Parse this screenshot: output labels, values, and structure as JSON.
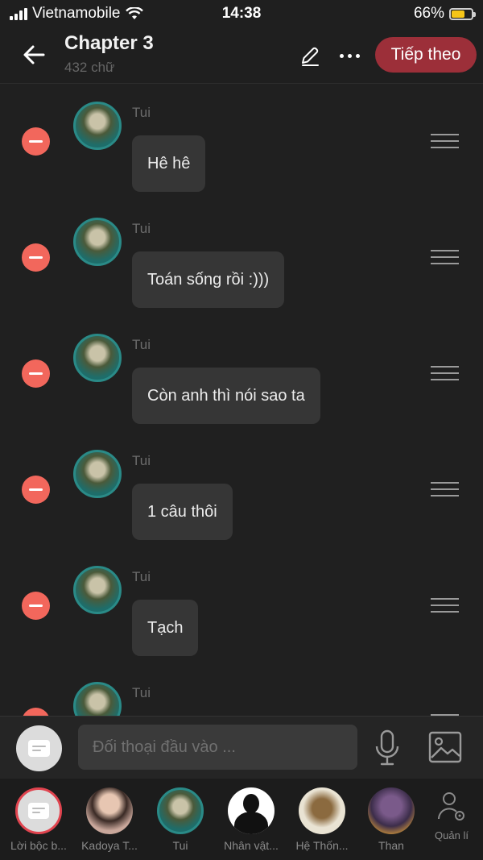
{
  "status_bar": {
    "carrier": "Vietnamobile",
    "time": "14:38",
    "battery": "66%",
    "battery_level": 0.66
  },
  "header": {
    "title": "Chapter 3",
    "word_count": "432 chữ",
    "next_label": "Tiếp theo"
  },
  "messages": [
    {
      "speaker": "Tui",
      "text": "Hê hê"
    },
    {
      "speaker": "Tui",
      "text": "Toán sống rồi :)))"
    },
    {
      "speaker": "Tui",
      "text": "Còn anh thì nói sao ta"
    },
    {
      "speaker": "Tui",
      "text": "1 câu thôi"
    },
    {
      "speaker": "Tui",
      "text": "Tạch"
    },
    {
      "speaker": "Tui",
      "text": ""
    }
  ],
  "input": {
    "placeholder": "Đối thoại đầu vào ..."
  },
  "characters": [
    {
      "label": "Lời bộc b..."
    },
    {
      "label": "Kadoya T..."
    },
    {
      "label": "Tui"
    },
    {
      "label": "Nhân vật..."
    },
    {
      "label": "Hệ Thốn..."
    },
    {
      "label": "Than"
    }
  ],
  "manage_label": "Quản lí",
  "colors": {
    "accent": "#9c2f39",
    "remove": "#f2675c",
    "background": "#202020"
  }
}
